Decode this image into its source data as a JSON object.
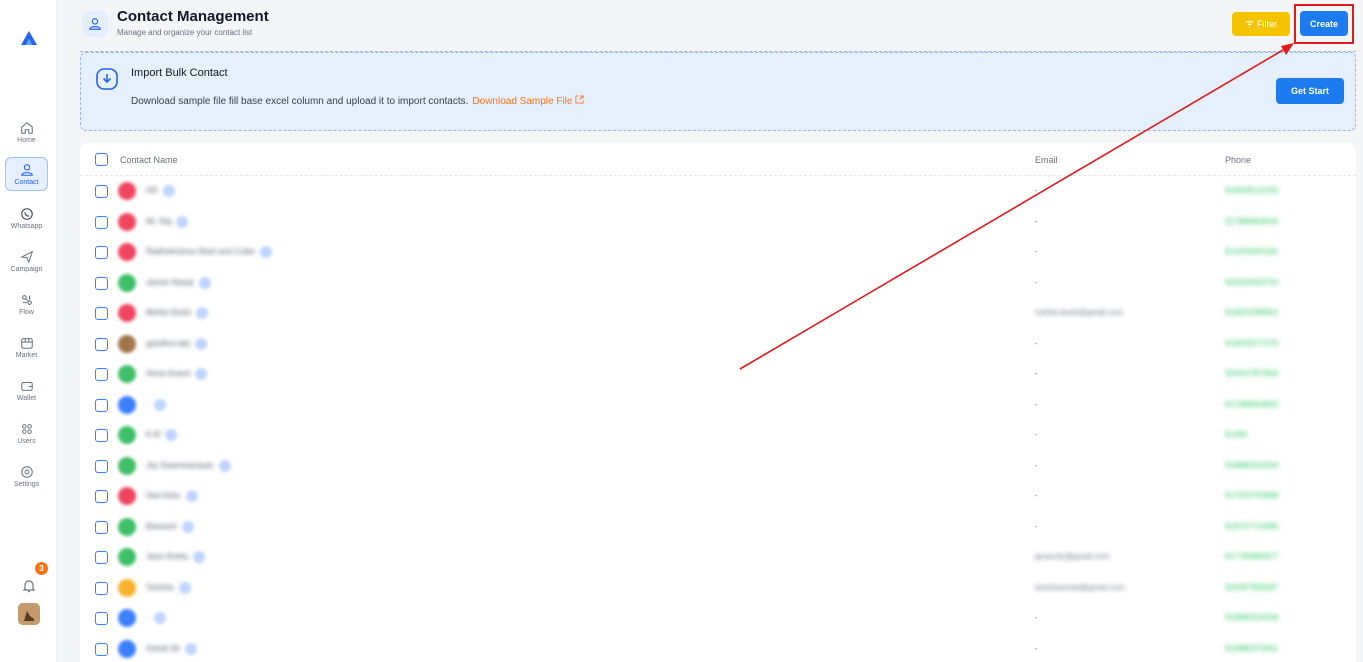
{
  "sidebar": {
    "items": [
      {
        "label": "Home",
        "icon": "home-icon"
      },
      {
        "label": "Contact",
        "icon": "contact-icon",
        "active": true
      },
      {
        "label": "Whatsapp",
        "icon": "whatsapp-icon"
      },
      {
        "label": "Campaign",
        "icon": "send-icon"
      },
      {
        "label": "Flow",
        "icon": "flow-icon"
      },
      {
        "label": "Market",
        "icon": "market-icon"
      },
      {
        "label": "Wallet",
        "icon": "wallet-icon"
      },
      {
        "label": "Users",
        "icon": "users-icon"
      },
      {
        "label": "Settings",
        "icon": "settings-icon"
      }
    ],
    "notification_count": "3"
  },
  "header": {
    "title": "Contact Management",
    "subtitle": "Manage and organize your contact list",
    "filter_label": "Filter",
    "create_label": "Create"
  },
  "import": {
    "title": "Import Bulk Contact",
    "description": "Download sample file fill base excel column and upload it to import contacts.",
    "link_label": "Download Sample File",
    "button_label": "Get Start"
  },
  "table": {
    "columns": [
      "Contact Name",
      "Email",
      "Phone"
    ],
    "rows": [
      {
        "name": "HR",
        "email": "-",
        "phone": "919638123762",
        "color": "#f0455f"
      },
      {
        "name": "Mr. Raj",
        "email": "-",
        "phone": "917889906543",
        "color": "#f0455f"
      },
      {
        "name": "Radhekrishna Steel and Cutter",
        "email": "-",
        "phone": "913334561160",
        "color": "#f0455f"
      },
      {
        "name": "Jaimin Rawal",
        "email": "-",
        "phone": "919204453743",
        "color": "#3fbf68"
      },
      {
        "name": "Mehta Doshi",
        "email": "mehta.doshi@gmail.com",
        "phone": "919623399902",
        "color": "#f0455f"
      },
      {
        "name": "guhdhra tats",
        "email": "-",
        "phone": "919033277270",
        "color": "#a0764a"
      },
      {
        "name": "Hena Anand",
        "email": "-",
        "phone": "919337357804",
        "color": "#3fbf68"
      },
      {
        "name": "-",
        "email": "-",
        "phone": "917088004605",
        "color": "#3b7fff"
      },
      {
        "name": "K.M",
        "email": "-",
        "phone": "91393",
        "color": "#3fbf68"
      },
      {
        "name": "Jay Swaminarayan",
        "email": "-",
        "phone": "919880332004",
        "color": "#3fbf68"
      },
      {
        "name": "Hari Ashu",
        "email": "-",
        "phone": "917323700068",
        "color": "#f0455f"
      },
      {
        "name": "Bhavesh",
        "email": "-",
        "phone": "919737710085",
        "color": "#3fbf68"
      },
      {
        "name": "Jana Shetty",
        "email": "janaonly@gmail.com",
        "phone": "917795880977",
        "color": "#3fbf68"
      },
      {
        "name": "Tanisha",
        "email": "tanishasmita@gmail.com",
        "phone": "919287900587",
        "color": "#f7b32b"
      },
      {
        "name": "-",
        "email": "-",
        "phone": "919890010039",
        "color": "#3b7fff"
      },
      {
        "name": "Ashok Sir",
        "email": "-",
        "phone": "919980370401",
        "color": "#3b7fff"
      }
    ]
  },
  "colors": {
    "accent": "#1d7bf0",
    "filter": "#f5c400",
    "link": "#f97316",
    "annotation": "#e01b1b"
  }
}
